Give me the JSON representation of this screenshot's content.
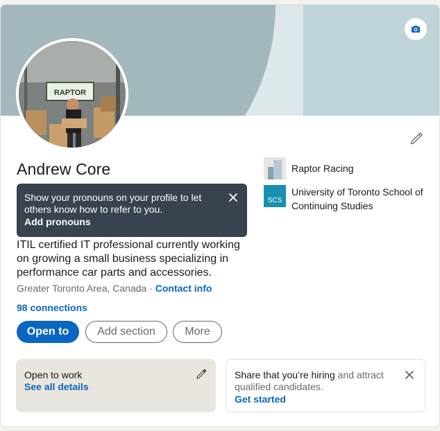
{
  "profile": {
    "name": "Andrew Core",
    "headline": "ITIL certified IT professional currently working on growing a small business specializing in performance car parts and accessories.",
    "location": "Greater Toronto Area, Canada",
    "separator": " · ",
    "contact_info_label": "Contact info",
    "connections_label": "98 connections",
    "avatar_sign_text": "RAPTOR"
  },
  "tooltip": {
    "text": "Show your pronouns on your profile to let others know how to refer to you.",
    "link": "Add pronouns"
  },
  "actions": {
    "open_to": "Open to",
    "add_section": "Add section",
    "more": "More"
  },
  "side": {
    "company": "Raptor Racing",
    "school": "University of Toronto School of Continuing Studies",
    "school_logo_text": "SCS"
  },
  "open_to_work": {
    "title": "Open to work",
    "link": "See all details"
  },
  "hiring": {
    "lead": "Share that you’re hiring",
    "rest": " and attract qualified candidates.",
    "link": "Get started"
  },
  "colors": {
    "accent": "#0a66c2",
    "tooltip_bg": "#38434f",
    "banner_dark": "#a3b8bd",
    "banner_light": "#dce8ea",
    "otw_bg": "#e9e5df"
  },
  "icons": {
    "camera": "camera-icon",
    "edit": "pencil-icon",
    "close": "close-icon"
  }
}
